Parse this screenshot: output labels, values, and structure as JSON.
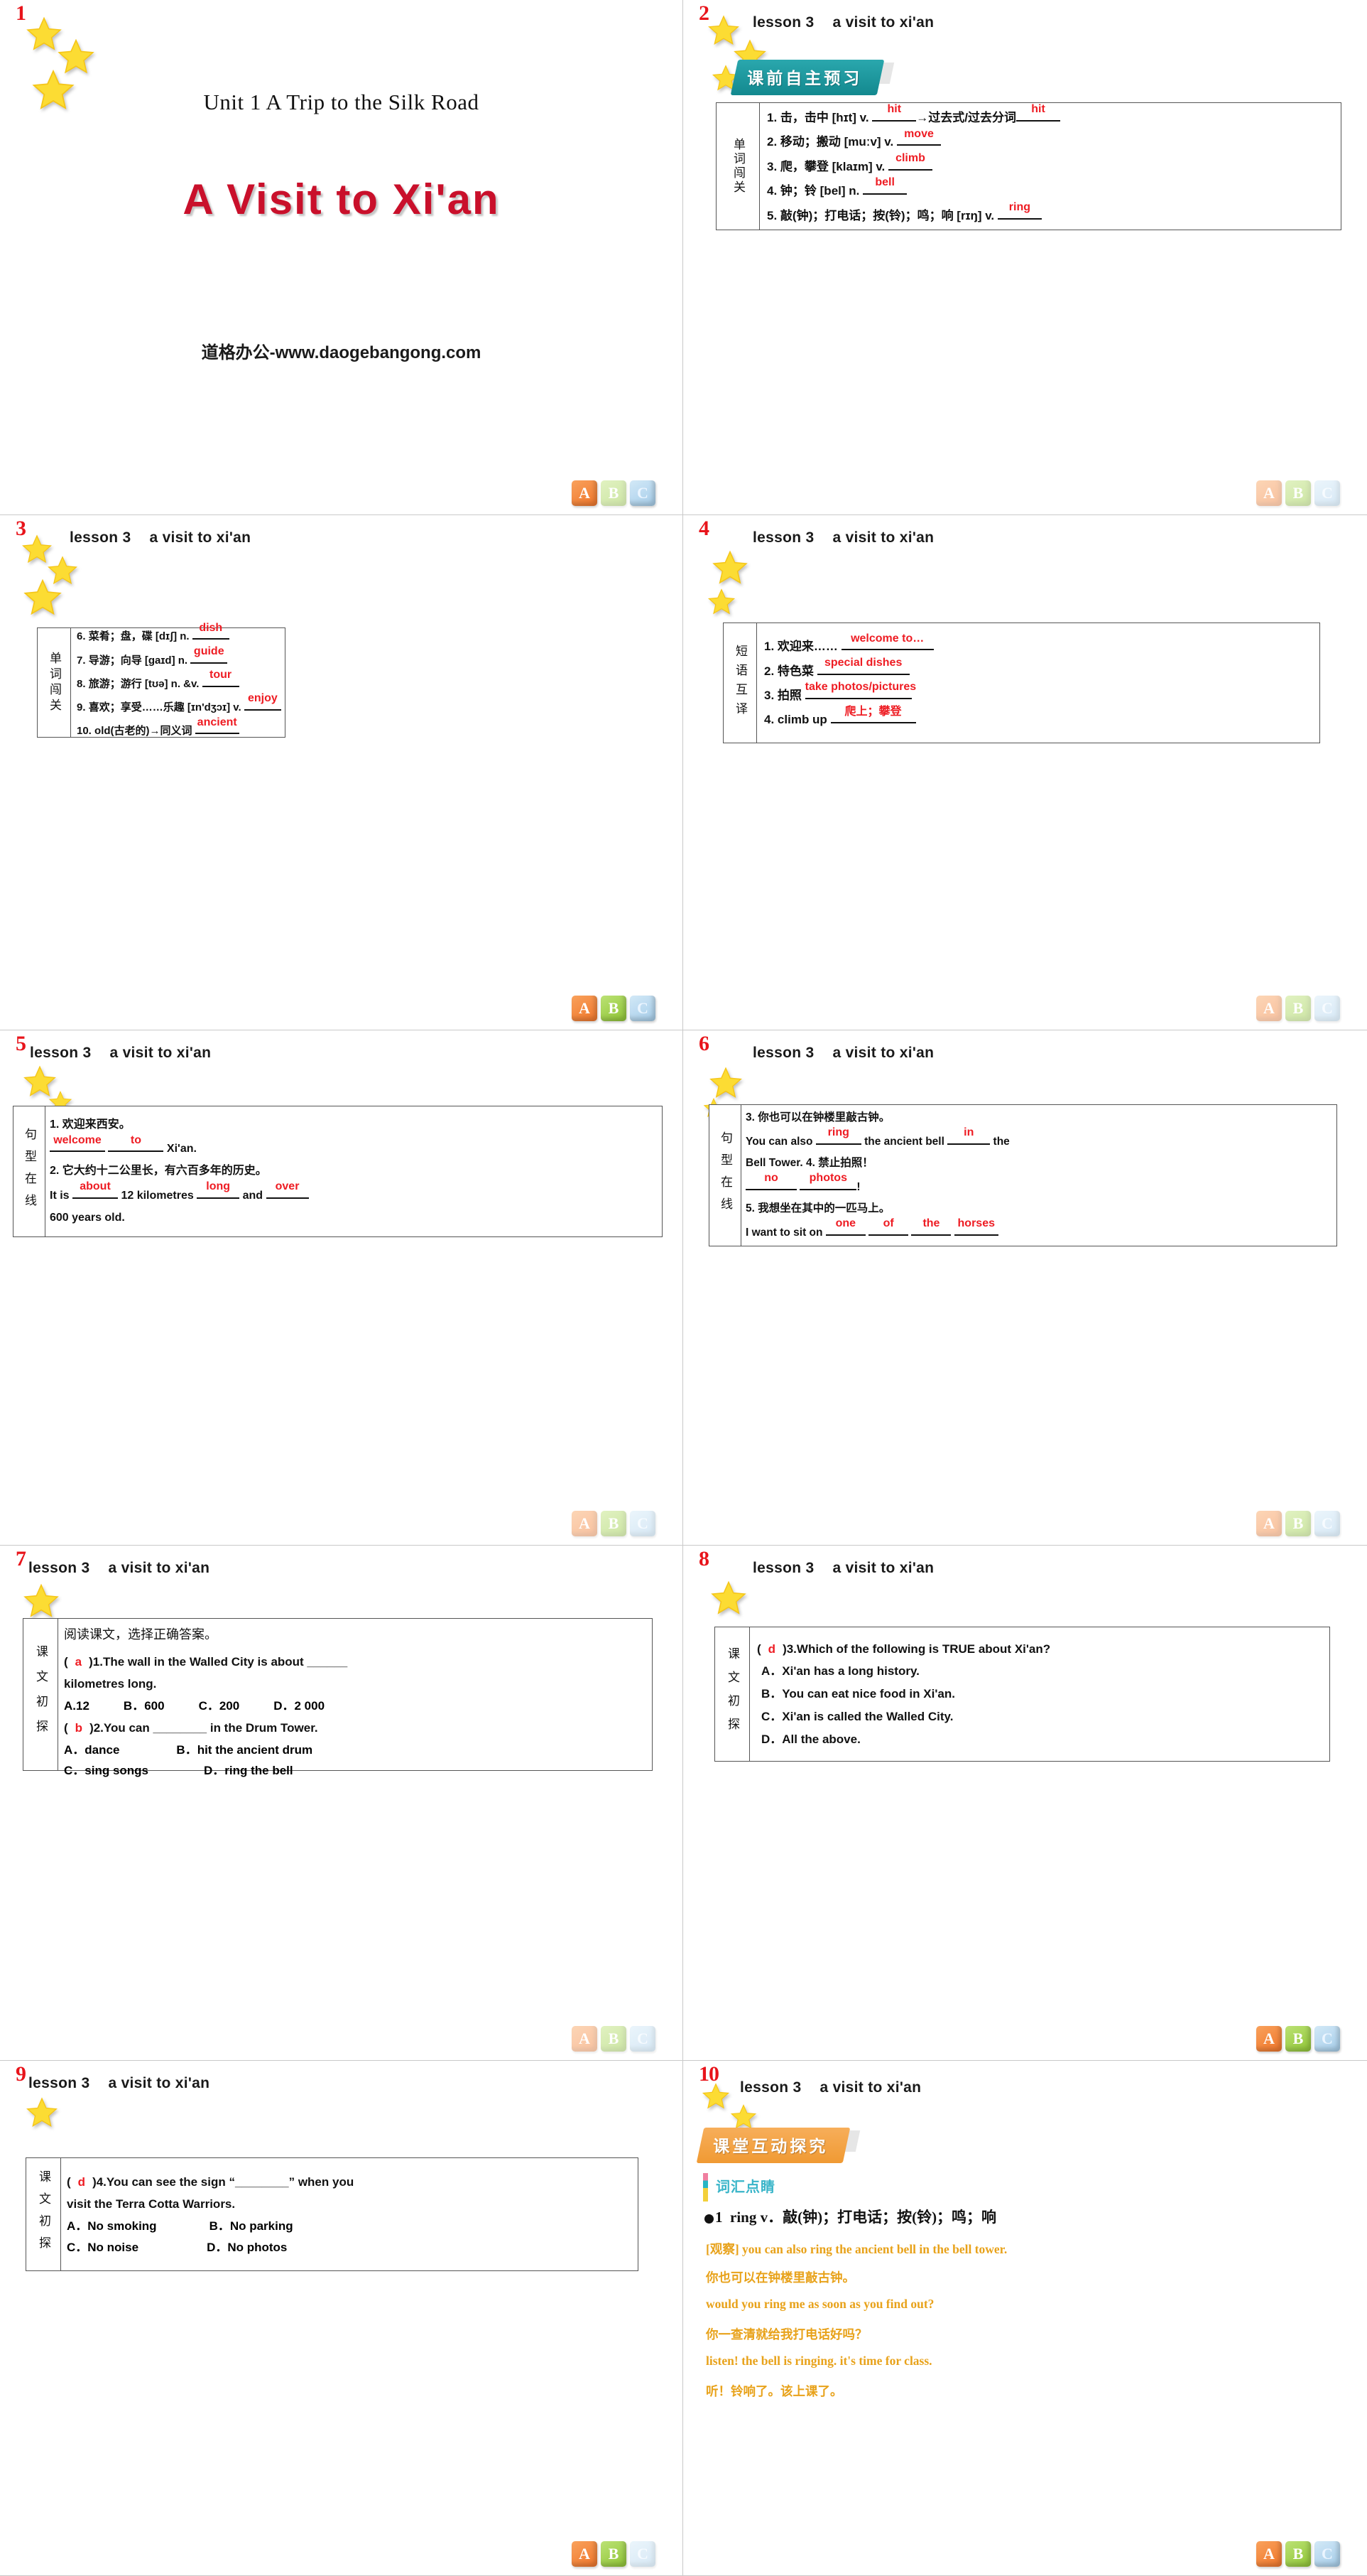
{
  "deck": {
    "watermark": "道格办公-www.daogebangong.com",
    "header_lesson": "lesson 3",
    "header_title": "a visit to xi'an",
    "abc_blocks": [
      "A",
      "B",
      "C"
    ],
    "accent_red": "#ee1c23",
    "accent_title_red": "#c9102b",
    "accent_teal": "#13898f",
    "accent_orange": "#f09a33",
    "accent_gold": "#e8a21a"
  },
  "slides": [
    {
      "number": "1",
      "unit_line": "Unit 1  A Trip to the Silk Road",
      "main_title": "A Visit to Xi'an",
      "watermark": "道格办公-www.daogebangong.com"
    },
    {
      "number": "2",
      "header_lesson": "lesson 3",
      "header_title": "a visit to xi'an",
      "banner": "课前自主预习",
      "box_label": "单词闯关",
      "rows": [
        {
          "num": "1.",
          "cn": "击，击中 [hɪt] v.",
          "answer": "hit",
          "tail": "→过去式/过去分词",
          "answer2": "hit"
        },
        {
          "num": "2.",
          "cn": "移动；搬动 [muːv] v.",
          "answer": "move"
        },
        {
          "num": "3.",
          "cn": "爬，攀登 [klaɪm] v.",
          "answer": "climb"
        },
        {
          "num": "4.",
          "cn": "钟；铃 [bel] n.",
          "answer": "bell"
        },
        {
          "num": "5.",
          "cn": "敲(钟)；打电话；按(铃)；鸣；响 [rɪŋ] v.",
          "answer": "ring"
        }
      ]
    },
    {
      "number": "3",
      "header_lesson": "lesson 3",
      "header_title": "a visit to xi'an",
      "box_label": "单词闯关",
      "rows": [
        {
          "num": "6.",
          "cn": "菜肴；盘，碟 [dɪʃ] n.",
          "answer": "dish"
        },
        {
          "num": "7.",
          "cn": "导游；向导 [gaɪd] n.",
          "answer": "guide"
        },
        {
          "num": "8.",
          "cn": "旅游；游行 [tʊə] n. &v.",
          "answer": "tour"
        },
        {
          "num": "9.",
          "cn": "喜欢；享受……乐趣 [ɪn'dʒɔɪ] v.",
          "answer": "enjoy"
        },
        {
          "num": "10.",
          "cn": "old(古老的)→同义词",
          "answer": "ancient"
        }
      ]
    },
    {
      "number": "4",
      "header_lesson": "lesson 3",
      "header_title": "a visit to xi'an",
      "box_label": "短语互译",
      "rows": [
        {
          "num": "1.",
          "cn": "欢迎来……",
          "answer": "welcome to…"
        },
        {
          "num": "2.",
          "cn": "特色菜",
          "answer": "special dishes"
        },
        {
          "num": "3.",
          "cn": "拍照",
          "answer": "take photos/pictures"
        },
        {
          "num": "4.",
          "cn": "climb up",
          "answer": "爬上；攀登"
        }
      ]
    },
    {
      "number": "5",
      "header_lesson": "lesson 3",
      "header_title": "a visit to xi'an",
      "box_label": "句型在线",
      "items": [
        {
          "num": "1.",
          "cn": "欢迎来西安。",
          "en_parts": [
            "",
            " ",
            " Xi'an."
          ],
          "answers": [
            "welcome",
            "to"
          ]
        },
        {
          "num": "2.",
          "cn": "它大约十二公里长，有六百多年的历史。",
          "en_prefix": "It is ",
          "answers": [
            "about",
            "long",
            "over"
          ],
          "mid1": " 12 kilometres ",
          "mid2": " and ",
          "tail": "600 years old."
        }
      ]
    },
    {
      "number": "6",
      "header_lesson": "lesson 3",
      "header_title": "a visit to xi'an",
      "box_label": "句型在线",
      "items": [
        {
          "num": "3.",
          "cn": "你也可以在钟楼里敲古钟。",
          "en_a": "You can also ",
          "ans1": "ring",
          "en_b": " the ancient bell ",
          "ans2": "in",
          "en_c": " the",
          "en_d": "Bell Tower."
        },
        {
          "num": "4.",
          "cn": "禁止拍照！",
          "answers": [
            "no",
            "photos"
          ],
          "bang": "!"
        },
        {
          "num": "5.",
          "cn": "我想坐在其中的一匹马上。",
          "en_a": "I want to sit on ",
          "answers4": [
            "one",
            "of",
            "the",
            "horses"
          ]
        }
      ]
    },
    {
      "number": "7",
      "header_lesson": "lesson 3",
      "header_title": "a visit to xi'an",
      "box_label": "课文初探",
      "instruction": "阅读课文，选择正确答案。",
      "questions": [
        {
          "pick": "a",
          "stem": ")1.The wall in the Walled City is about ______",
          "stem2": "kilometres long.",
          "options": [
            "A.12",
            "B．600",
            "C．200",
            "D．2 000"
          ]
        },
        {
          "pick": "b",
          "stem": ")2.You can ________ in the Drum Tower.",
          "options_rows": [
            [
              "A．dance",
              "B．hit the ancient drum"
            ],
            [
              "C．sing songs",
              "D．ring the bell"
            ]
          ]
        }
      ]
    },
    {
      "number": "8",
      "header_lesson": "lesson 3",
      "header_title": "a visit to xi'an",
      "box_label": "课文初探",
      "questions": [
        {
          "pick": "d",
          "stem": ")3.Which of the following is TRUE about Xi'an?",
          "options": [
            "A．Xi'an has a long history.",
            "B．You can eat nice food in Xi'an.",
            "C．Xi'an is called the Walled City.",
            "D．All the above."
          ]
        }
      ]
    },
    {
      "number": "9",
      "header_lesson": "lesson 3",
      "header_title": "a visit to xi'an",
      "box_label": "课文初探",
      "questions": [
        {
          "pick": "d",
          "stem": ")4.You can see the sign “________” when you",
          "stem2": "visit the Terra Cotta Warriors.",
          "options_rows": [
            [
              "A．No smoking",
              "B．No parking"
            ],
            [
              "C．No noise",
              "D．No photos"
            ]
          ]
        }
      ]
    },
    {
      "number": "10",
      "header_lesson": "lesson 3",
      "header_title": "a visit to xi'an",
      "banner": "课堂互动探究",
      "subhead": "词汇点睛",
      "entry_num": "1",
      "entry": "ring v．敲(钟)；打电话；按(铃)；鸣；响",
      "notes": [
        "[观察] you can also ring the ancient bell in the bell tower.",
        "你也可以在钟楼里敲古钟。",
        "would you ring me as soon as you find out?",
        "你一查清就给我打电话好吗？",
        "listen! the bell is ringing. it's time for class.",
        "听！铃响了。该上课了。"
      ]
    }
  ]
}
